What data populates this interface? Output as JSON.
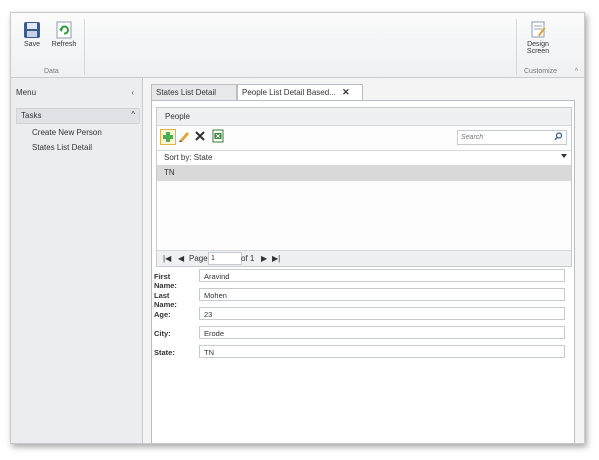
{
  "ribbon": {
    "save_label": "Save",
    "refresh_label": "Refresh",
    "data_group_label": "Data",
    "design_label_1": "Design",
    "design_label_2": "Screen",
    "customize_group_label": "Customize"
  },
  "menu": {
    "title": "Menu",
    "tasks_label": "Tasks",
    "items": [
      {
        "label": "Create New Person"
      },
      {
        "label": "States List Detail"
      }
    ]
  },
  "tabs": [
    {
      "label": "States List Detail"
    },
    {
      "label": "People List Detail Based..."
    }
  ],
  "people": {
    "group_title": "People",
    "search_placeholder": "Search",
    "sort_label": "Sort by: State",
    "rows": [
      "TN"
    ],
    "pager": {
      "page_label": "Page",
      "page_value": "1",
      "of_label": "of 1"
    }
  },
  "form": {
    "fields": [
      {
        "label": "First Name:",
        "value": "Aravind"
      },
      {
        "label": "Last Name:",
        "value": "Mohen"
      },
      {
        "label": "Age:",
        "value": "23"
      },
      {
        "label": "City:",
        "value": "Erode"
      },
      {
        "label": "State:",
        "value": "TN"
      }
    ]
  },
  "colors": {
    "add_icon": "#4caf50",
    "accent_border": "#e3b34a"
  }
}
